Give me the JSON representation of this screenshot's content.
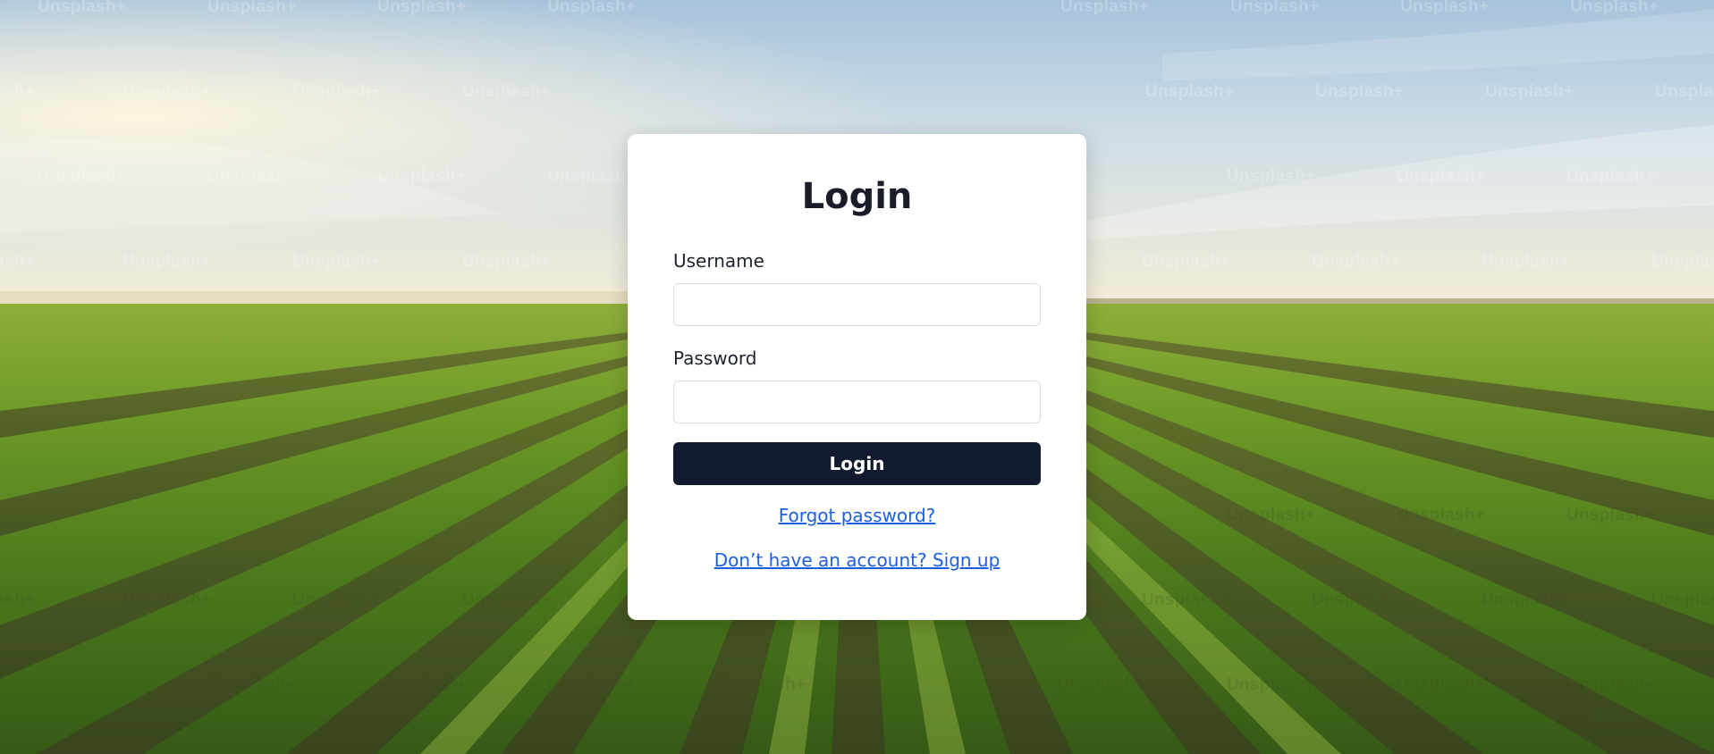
{
  "background": {
    "watermark_text": "Unsplash+",
    "sky_top": "#a9c4dd",
    "sky_horizon": "#f4efe0",
    "field_near": "#3f6a1a",
    "field_far": "#6f9a2c"
  },
  "login_card": {
    "title": "Login",
    "username": {
      "label": "Username",
      "value": "",
      "placeholder": ""
    },
    "password": {
      "label": "Password",
      "value": "",
      "placeholder": ""
    },
    "submit_label": "Login",
    "forgot_link": "Forgot password?",
    "signup_link": "Don’t have an account? Sign up"
  },
  "colors": {
    "button_bg": "#121a2f",
    "link": "#1d5fe0",
    "title": "#1a1d29"
  }
}
